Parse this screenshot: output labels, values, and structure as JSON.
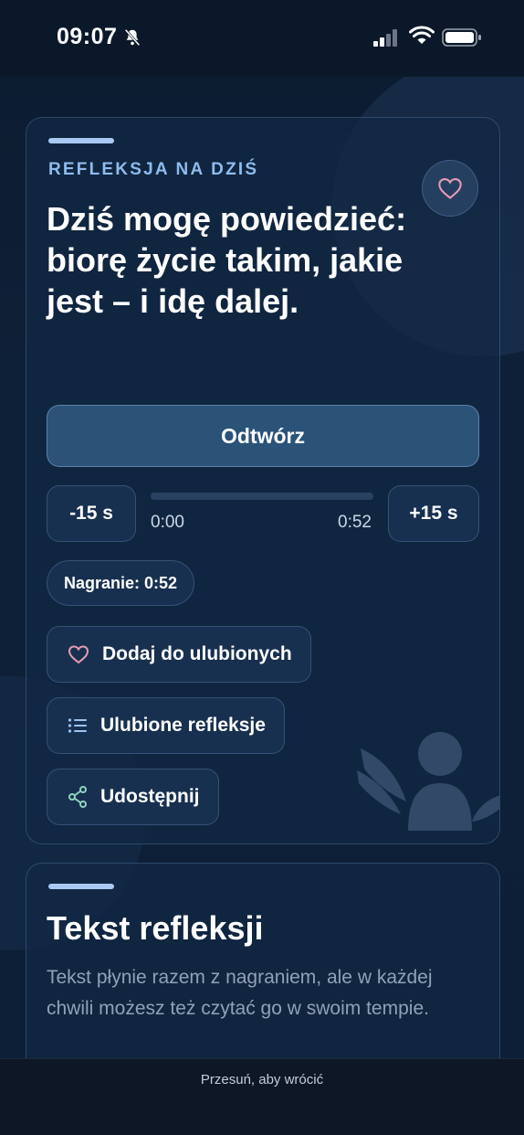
{
  "status_bar": {
    "time": "09:07",
    "icons": [
      "bell-slash-icon",
      "signal-icon",
      "wifi-icon",
      "battery-icon"
    ]
  },
  "reflection_card": {
    "eyebrow": "REFLEKSJA NA DZIŚ",
    "headline": "Dziś mogę powiedzieć: biorę życie takim, jakie jest – i idę dalej.",
    "favorite_icon": "heart-icon",
    "player": {
      "play_label": "Odtwórz",
      "skip_back_label": "-15 s",
      "skip_forward_label": "+15 s",
      "current_time": "0:00",
      "total_time": "0:52",
      "progress": 0
    },
    "recording_label": "Nagranie: 0:52",
    "actions": {
      "add_favorite": "Dodaj do ulubionych",
      "favorites_list": "Ulubione refleksje",
      "share": "Udostępnij"
    }
  },
  "text_card": {
    "title": "Tekst refleksji",
    "body": "Tekst płynie razem z nagraniem, ale w każdej chwili możesz też czytać go w swoim tempie."
  },
  "bottom_bar": {
    "hint": "Przesuń, aby wrócić"
  },
  "colors": {
    "background": "#0c1b2f",
    "accent": "#8fbbef",
    "play_button": "#2b5378",
    "heart": "#e59ab4"
  }
}
